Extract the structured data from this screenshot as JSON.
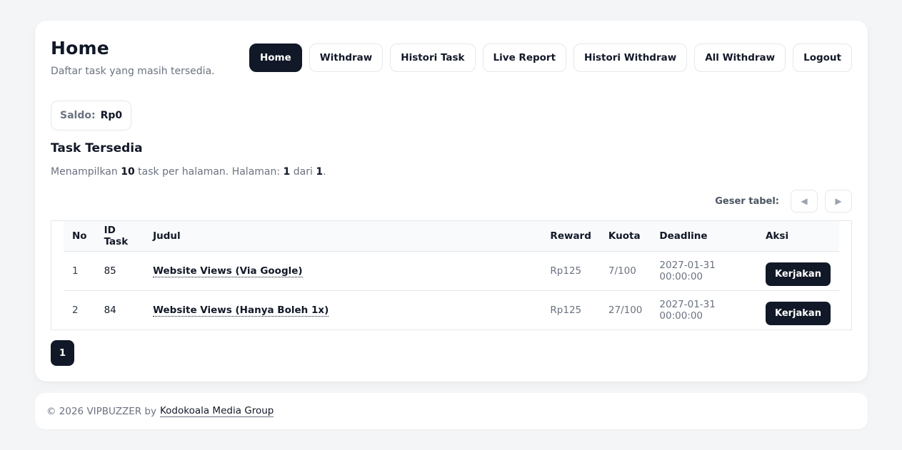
{
  "header": {
    "title": "Home",
    "subtitle": "Daftar task yang masih tersedia."
  },
  "nav": {
    "items": [
      {
        "label": "Home",
        "active": true
      },
      {
        "label": "Withdraw"
      },
      {
        "label": "Histori Task"
      },
      {
        "label": "Live Report"
      },
      {
        "label": "Histori Withdraw"
      },
      {
        "label": "All Withdraw"
      },
      {
        "label": "Logout"
      }
    ]
  },
  "saldo": {
    "label": "Saldo:",
    "value": "Rp0"
  },
  "section": {
    "title": "Task Tersedia",
    "info_prefix": "Menampilkan",
    "per_page": "10",
    "info_mid": "task per halaman. Halaman:",
    "page": "1",
    "info_of": "dari",
    "total_pages": "1",
    "info_end": "."
  },
  "scroll": {
    "label": "Geser tabel:",
    "left_icon": "◀",
    "right_icon": "▶"
  },
  "table": {
    "columns": [
      "No",
      "ID Task",
      "Judul",
      "Reward",
      "Kuota",
      "Deadline",
      "Aksi"
    ],
    "rows": [
      {
        "no": "1",
        "id": "85",
        "title": "Website Views (Via Google)",
        "reward": "Rp125",
        "quota": "7/100",
        "deadline": "2027-01-31 00:00:00",
        "action": "Kerjakan"
      },
      {
        "no": "2",
        "id": "84",
        "title": "Website Views (Hanya Boleh 1x)",
        "reward": "Rp125",
        "quota": "27/100",
        "deadline": "2027-01-31 00:00:00",
        "action": "Kerjakan"
      }
    ]
  },
  "pagination": {
    "current": "1"
  },
  "footer": {
    "text": "© 2026 VIPBUZZER by",
    "link": "Kodokoala Media Group"
  }
}
